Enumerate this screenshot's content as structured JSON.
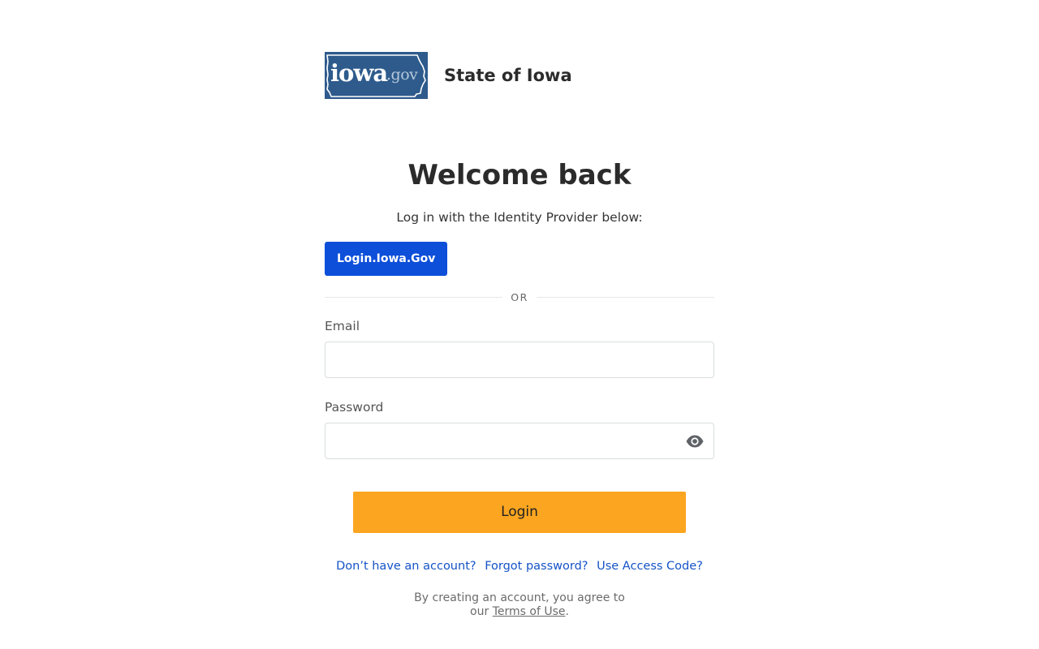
{
  "brand": {
    "logo_word": "iowa",
    "logo_suffix": ".gov",
    "title": "State of Iowa"
  },
  "heading": "Welcome back",
  "subtitle": "Log in with the Identity Provider below:",
  "idp_button": "Login.Iowa.Gov",
  "divider": "OR",
  "form": {
    "email_label": "Email",
    "email_value": "",
    "password_label": "Password",
    "password_value": "",
    "password_toggle_icon": "eye-icon",
    "submit_label": "Login"
  },
  "links": {
    "signup": "Don’t have an account?",
    "forgot": "Forgot password?",
    "access_code": "Use Access Code?"
  },
  "terms": {
    "line1": "By creating an account, you agree to",
    "prefix": "our",
    "link": "Terms of Use",
    "suffix": "."
  },
  "colors": {
    "idp_button": "#0d4fd9",
    "login_button": "#fba520",
    "link": "#1453c7",
    "logo_background": "#2e5b8c"
  }
}
